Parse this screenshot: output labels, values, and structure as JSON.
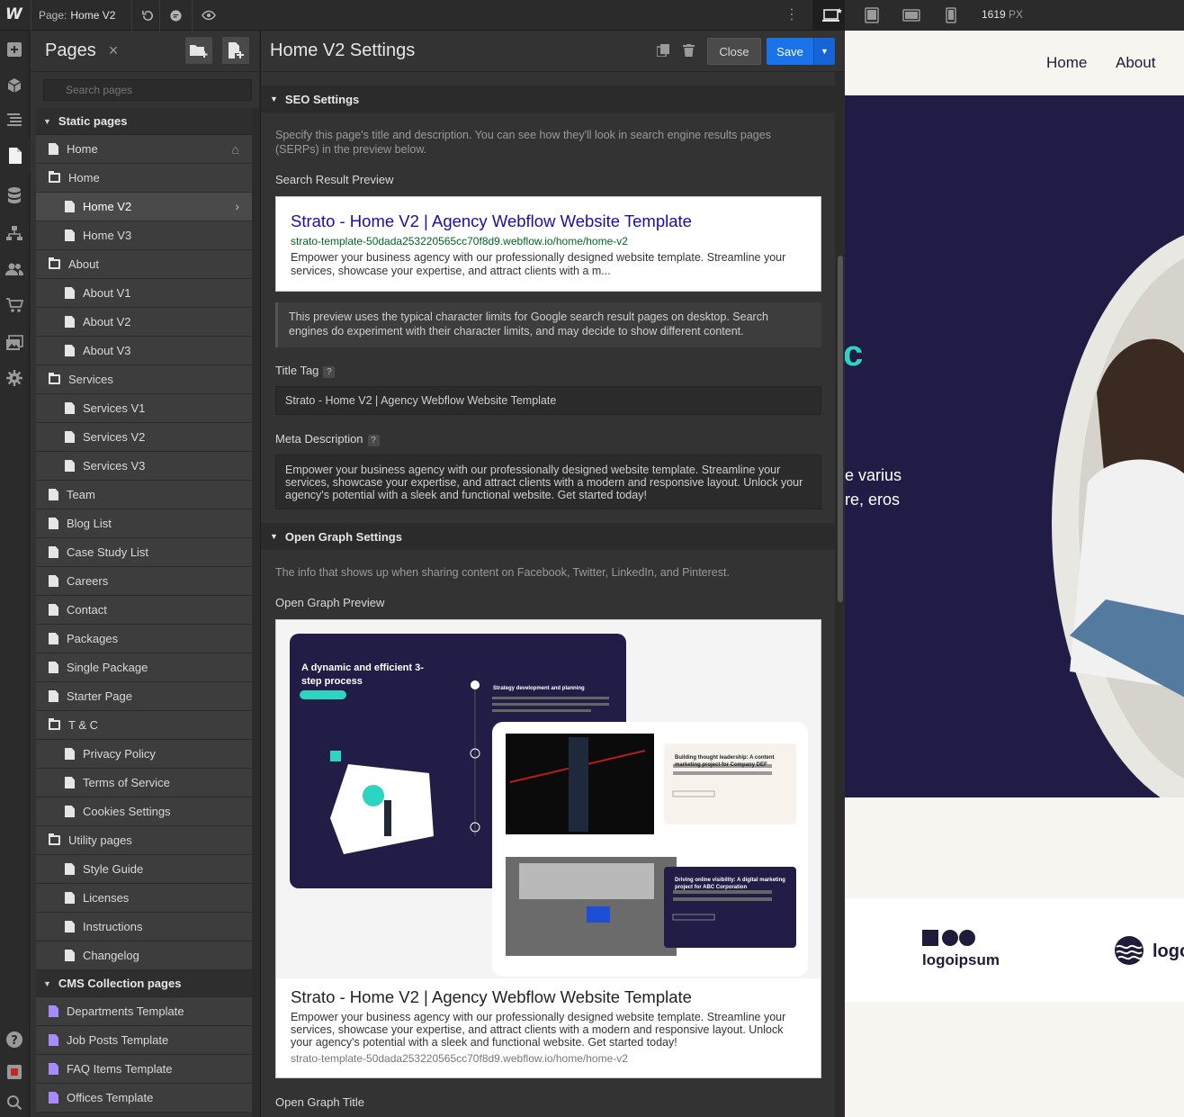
{
  "topbar": {
    "logo": "W",
    "page_prefix": "Page:",
    "page_name": "Home V2",
    "width_value": "1619",
    "width_unit": "PX"
  },
  "pages_panel": {
    "title": "Pages",
    "search_placeholder": "Search pages",
    "static_section": "Static pages",
    "cms_section": "CMS Collection pages",
    "static_items": [
      {
        "label": "Home",
        "type": "page",
        "level": 0,
        "home": true
      },
      {
        "label": "Home",
        "type": "folder",
        "level": 0
      },
      {
        "label": "Home V2",
        "type": "page",
        "level": 1,
        "selected": true
      },
      {
        "label": "Home V3",
        "type": "page",
        "level": 1
      },
      {
        "label": "About",
        "type": "folder",
        "level": 0
      },
      {
        "label": "About V1",
        "type": "page",
        "level": 1
      },
      {
        "label": "About V2",
        "type": "page",
        "level": 1
      },
      {
        "label": "About V3",
        "type": "page",
        "level": 1
      },
      {
        "label": "Services",
        "type": "folder",
        "level": 0
      },
      {
        "label": "Services V1",
        "type": "page",
        "level": 1
      },
      {
        "label": "Services V2",
        "type": "page",
        "level": 1
      },
      {
        "label": "Services V3",
        "type": "page",
        "level": 1
      },
      {
        "label": "Team",
        "type": "page",
        "level": 0
      },
      {
        "label": "Blog List",
        "type": "page",
        "level": 0
      },
      {
        "label": "Case Study List",
        "type": "page",
        "level": 0
      },
      {
        "label": "Careers",
        "type": "page",
        "level": 0
      },
      {
        "label": "Contact",
        "type": "page",
        "level": 0
      },
      {
        "label": "Packages",
        "type": "page",
        "level": 0
      },
      {
        "label": "Single Package",
        "type": "page",
        "level": 0
      },
      {
        "label": "Starter Page",
        "type": "page",
        "level": 0
      },
      {
        "label": "T & C",
        "type": "folder",
        "level": 0
      },
      {
        "label": "Privacy Policy",
        "type": "page",
        "level": 1
      },
      {
        "label": "Terms of Service",
        "type": "page",
        "level": 1
      },
      {
        "label": "Cookies Settings",
        "type": "page",
        "level": 1
      },
      {
        "label": "Utility pages",
        "type": "folder",
        "level": 0
      },
      {
        "label": "Style Guide",
        "type": "page",
        "level": 1
      },
      {
        "label": "Licenses",
        "type": "page",
        "level": 1
      },
      {
        "label": "Instructions",
        "type": "page",
        "level": 1
      },
      {
        "label": "Changelog",
        "type": "page",
        "level": 1
      }
    ],
    "cms_items": [
      {
        "label": "Departments Template"
      },
      {
        "label": "Job Posts Template"
      },
      {
        "label": "FAQ Items Template"
      },
      {
        "label": "Offices Template"
      }
    ]
  },
  "settings": {
    "title": "Home V2 Settings",
    "close_label": "Close",
    "save_label": "Save",
    "seo": {
      "heading": "SEO Settings",
      "intro": "Specify this page's title and description. You can see how they'll look in search engine results pages (SERPs) in the preview below.",
      "preview_label": "Search Result Preview",
      "serp_title": "Strato - Home V2 | Agency Webflow Website Template",
      "serp_url": "strato-template-50dada253220565cc70f8d9.webflow.io/home/home-v2",
      "serp_desc": "Empower your business agency with our professionally designed website template. Streamline your services, showcase your expertise, and attract clients with a m...",
      "note": "This preview uses the typical character limits for Google search result pages on desktop. Search engines do experiment with their character limits, and may decide to show different content.",
      "title_tag_label": "Title Tag",
      "title_tag_value": "Strato - Home V2 | Agency Webflow Website Template",
      "meta_label": "Meta Description",
      "meta_value": "Empower your business agency with our professionally designed website template. Streamline your services, showcase your expertise, and attract clients with a modern and responsive layout. Unlock your agency's potential with a sleek and functional website. Get started today!",
      "help": "?"
    },
    "og": {
      "heading": "Open Graph Settings",
      "intro": "The info that shows up when sharing content on Facebook, Twitter, LinkedIn, and Pinterest.",
      "preview_label": "Open Graph Preview",
      "card_title": "Strato - Home V2 | Agency Webflow Website Template",
      "card_desc": "Empower your business agency with our professionally designed website template. Streamline your services, showcase your expertise, and attract clients with a modern and responsive layout. Unlock your agency's potential with a sleek and functional website. Get started today!",
      "card_url": "strato-template-50dada253220565cc70f8d9.webflow.io/home/home-v2",
      "title_label": "Open Graph Title",
      "image": {
        "process_title": "A dynamic and efficient 3-step process",
        "step_title": "Strategy development and planning",
        "case1_title": "Building thought leadership: A content marketing project for Company DEF",
        "case2_title": "Driving online visibility: A digital marketing project for ABC Corporation"
      }
    }
  },
  "preview": {
    "nav_home": "Home",
    "nav_about": "About",
    "hero_line1": "e varius",
    "hero_line2": "re, eros",
    "logo1": "logoipsum",
    "logo2": "logo"
  }
}
